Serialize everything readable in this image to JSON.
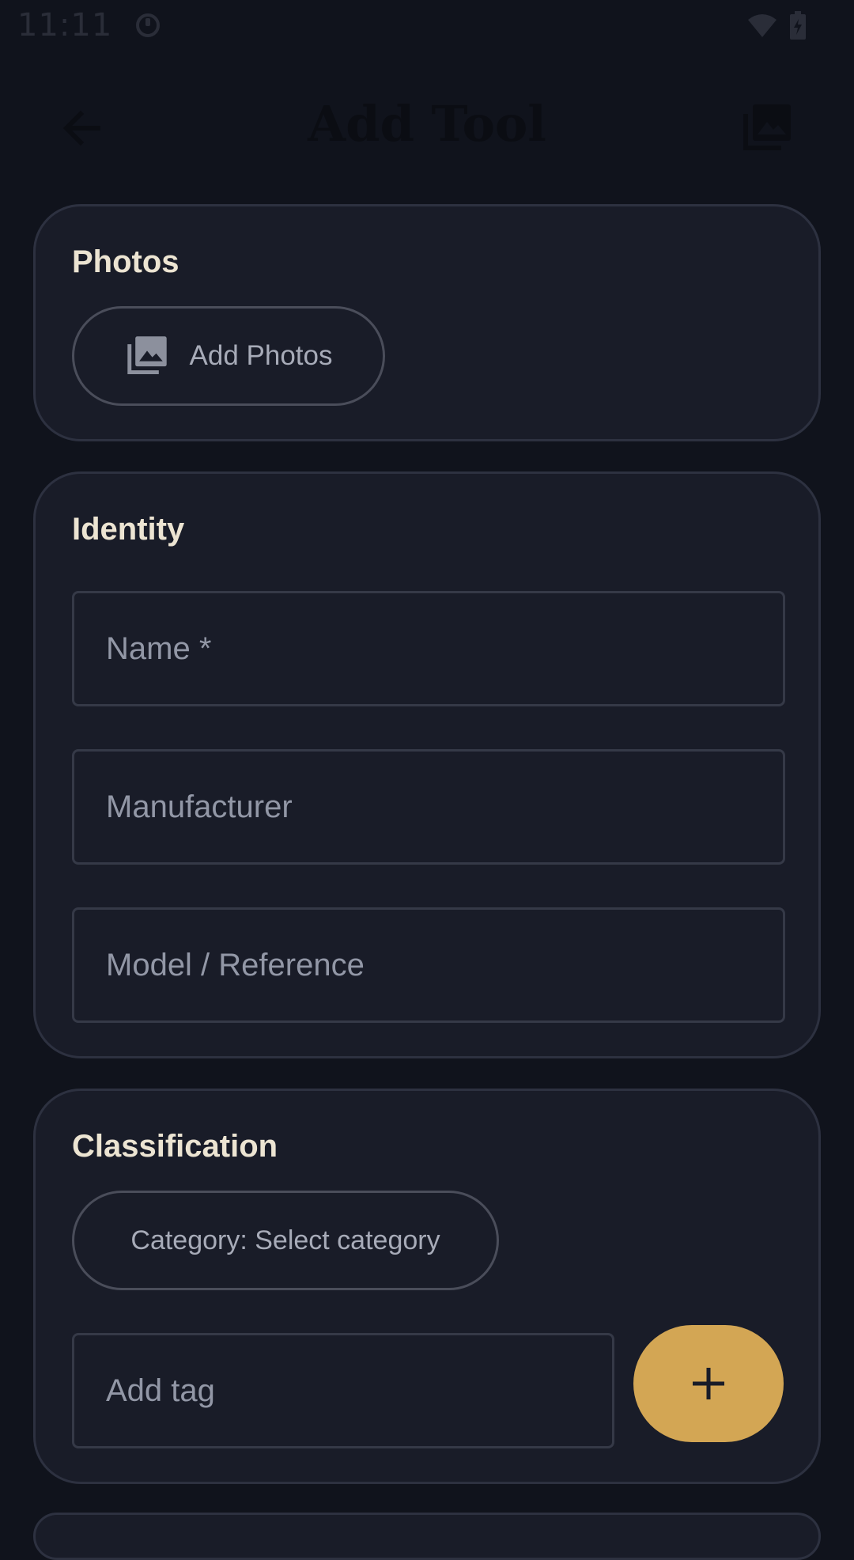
{
  "status": {
    "time": "11:11"
  },
  "header": {
    "title": "Add Tool",
    "back_icon": "arrow-left-icon",
    "action_icon": "photo-library-icon"
  },
  "photos": {
    "title": "Photos",
    "add_label": "Add Photos"
  },
  "identity": {
    "title": "Identity",
    "name_placeholder": "Name *",
    "manufacturer_placeholder": "Manufacturer",
    "model_placeholder": "Model / Reference"
  },
  "classification": {
    "title": "Classification",
    "category_label": "Category: Select category",
    "tag_placeholder": "Add tag"
  },
  "colors": {
    "background": "#10131c",
    "card": "#191c28",
    "accent": "#d3a654"
  }
}
